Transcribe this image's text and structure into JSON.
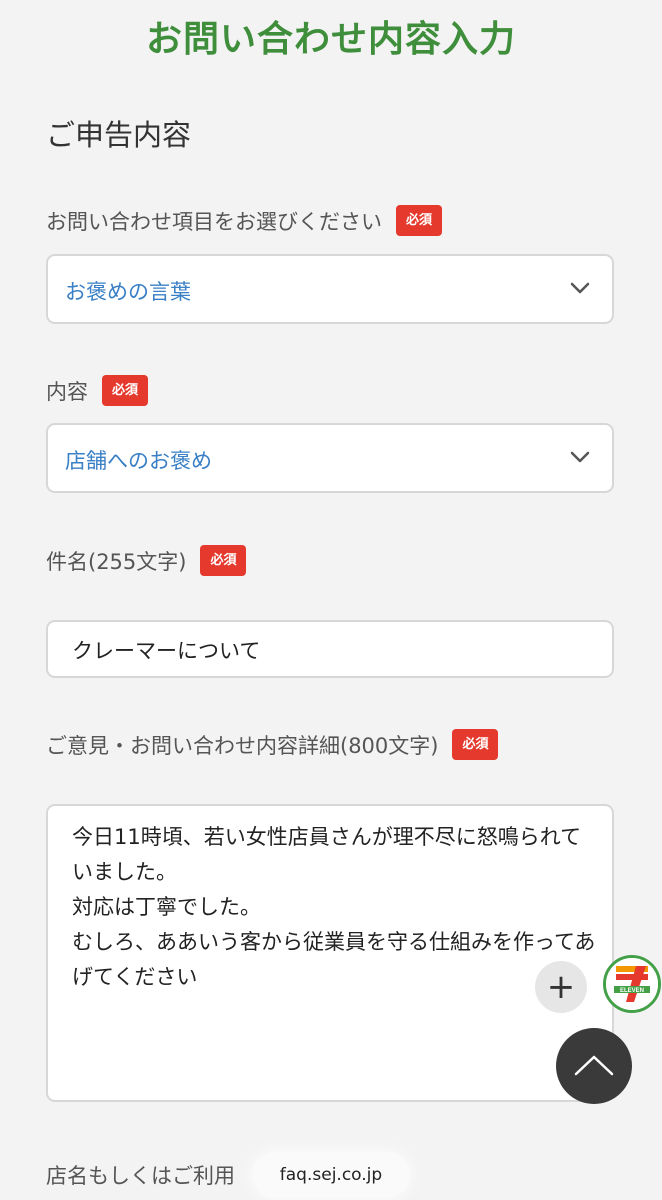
{
  "header": {
    "title": "お問い合わせ内容入力"
  },
  "section": {
    "heading": "ご申告内容"
  },
  "required_label": "必須",
  "fields": {
    "inquiry_item": {
      "label": "お問い合わせ項目をお選びください",
      "value": "お褒めの言葉"
    },
    "content": {
      "label": "内容",
      "value": "店舗へのお褒め"
    },
    "subject": {
      "label": "件名(255文字)",
      "value": "クレーマーについて"
    },
    "detail": {
      "label": "ご意見・お問い合わせ内容詳細(800文字)",
      "value": "今日11時頃、若い女性店員さんが理不尽に怒鳴られていました。\n対応は丁寧でした。\nむしろ、ああいう客から従業員を守る仕組みを作ってあげてください"
    },
    "store_name": {
      "label": "店名もしくはご利用"
    }
  },
  "floating": {
    "plus_label": "+",
    "logo_text": "7 ELEVEN"
  },
  "browser": {
    "url": "faq.sej.co.jp"
  },
  "colors": {
    "title_green": "#3f8e3c",
    "required_red": "#e4392c",
    "select_blue": "#3a80c6"
  }
}
